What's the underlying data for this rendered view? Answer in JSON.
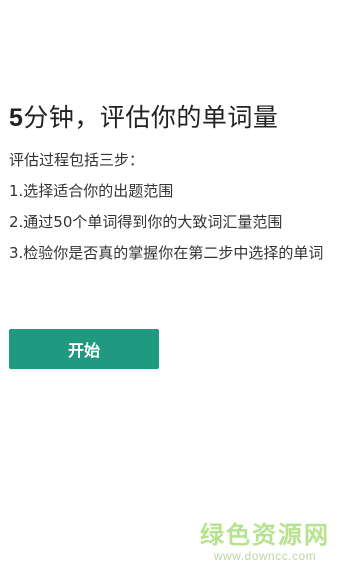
{
  "header": {
    "title_number": "5",
    "title_text": "分钟，评估你的单词量"
  },
  "intro": "评估过程包括三步：",
  "steps": [
    {
      "label": "1.选择适合你的出题范围"
    },
    {
      "label": "2.通过50个单词得到你的大致词汇量范围"
    },
    {
      "label": "3.检验你是否真的掌握你在第二步中选择的单词"
    }
  ],
  "actions": {
    "start_label": "开始"
  },
  "watermark": {
    "main": "绿色资源网",
    "sub": "www.downcc.com"
  },
  "colors": {
    "primary_button": "#1f9980",
    "watermark": "#9fd96a"
  }
}
